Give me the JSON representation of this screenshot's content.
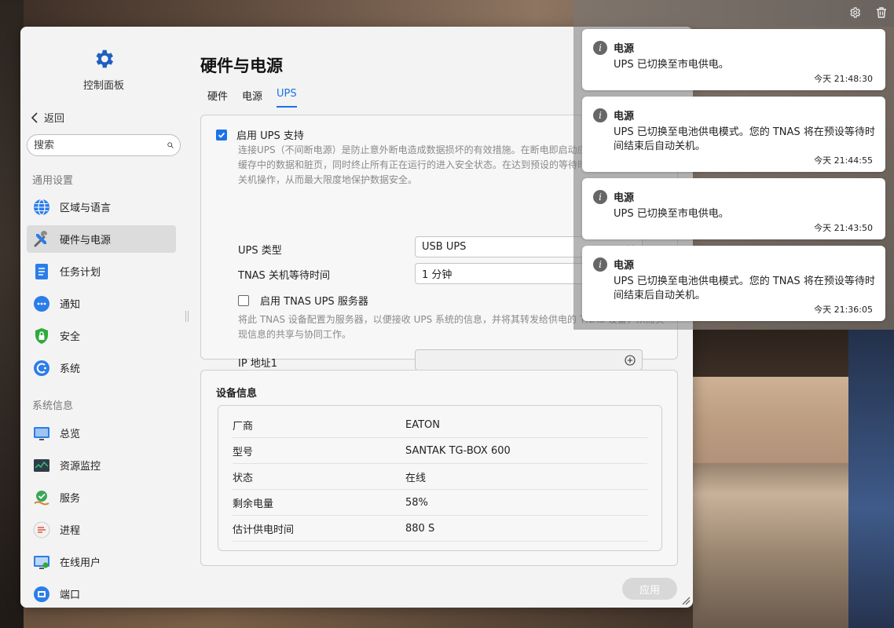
{
  "app": {
    "title": "控制面板",
    "back_label": "返回",
    "search_placeholder": "搜索"
  },
  "sidebar": {
    "sections": [
      {
        "label": "通用设置",
        "items": [
          {
            "label": "区域与语言",
            "icon": "globe-icon"
          },
          {
            "label": "硬件与电源",
            "icon": "tools-icon",
            "active": true
          },
          {
            "label": "任务计划",
            "icon": "task-list-icon"
          },
          {
            "label": "通知",
            "icon": "chat-bubble-icon"
          },
          {
            "label": "安全",
            "icon": "shield-lock-icon"
          },
          {
            "label": "系统",
            "icon": "system-icon"
          }
        ]
      },
      {
        "label": "系统信息",
        "items": [
          {
            "label": "总览",
            "icon": "monitor-icon"
          },
          {
            "label": "资源监控",
            "icon": "resource-monitor-icon"
          },
          {
            "label": "服务",
            "icon": "service-icon"
          },
          {
            "label": "进程",
            "icon": "process-icon"
          },
          {
            "label": "在线用户",
            "icon": "online-user-icon"
          },
          {
            "label": "端口",
            "icon": "port-icon"
          }
        ]
      }
    ]
  },
  "main": {
    "title": "硬件与电源",
    "tabs": [
      {
        "label": "硬件"
      },
      {
        "label": "电源"
      },
      {
        "label": "UPS",
        "active": true
      }
    ],
    "ups": {
      "enable_label": "启用 UPS 支持",
      "enable_checked": true,
      "description": "连接UPS（不间断电源）是防止意外断电造成数据损坏的有效措施。在断电即启动应急响应，自动回写缓存中的数据和脏页，同时终止所有正在运行的进入安全状态。在达到预设的等待时间后，会自动执行关机操作，从而最大限度地保护数据安全。",
      "type_label": "UPS 类型",
      "type_value": "USB UPS",
      "wait_label": "TNAS 关机等待时间",
      "wait_value": "1 分钟",
      "server_label": "启用 TNAS UPS 服务器",
      "server_checked": false,
      "server_description": "将此 TNAS 设备配置为服务器，以便接收 UPS 系统的信息，并将其转发给供电的 TNAS 设备，从而实现信息的共享与协同工作。",
      "ip_label": "IP 地址1",
      "ip_value": ""
    },
    "device": {
      "title": "设备信息",
      "rows": [
        {
          "key": "厂商",
          "value": "EATON"
        },
        {
          "key": "型号",
          "value": "SANTAK TG-BOX 600"
        },
        {
          "key": "状态",
          "value": "在线"
        },
        {
          "key": "剩余电量",
          "value": "58%"
        },
        {
          "key": "估计供电时间",
          "value": "880 S"
        }
      ]
    },
    "apply_label": "应用"
  },
  "notifications": [
    {
      "title": "电源",
      "body": "UPS 已切换至市电供电。",
      "time": "今天 21:48:30"
    },
    {
      "title": "电源",
      "body": "UPS 已切换至电池供电模式。您的 TNAS 将在预设等待时间结束后自动关机。",
      "time": "今天 21:44:55"
    },
    {
      "title": "电源",
      "body": "UPS 已切换至市电供电。",
      "time": "今天 21:43:50"
    },
    {
      "title": "电源",
      "body": "UPS 已切换至电池供电模式。您的 TNAS 将在预设等待时间结束后自动关机。",
      "time": "今天 21:36:05"
    }
  ],
  "colors": {
    "accent": "#1a73e8",
    "active_nav_bg": "#dcdcdc"
  }
}
